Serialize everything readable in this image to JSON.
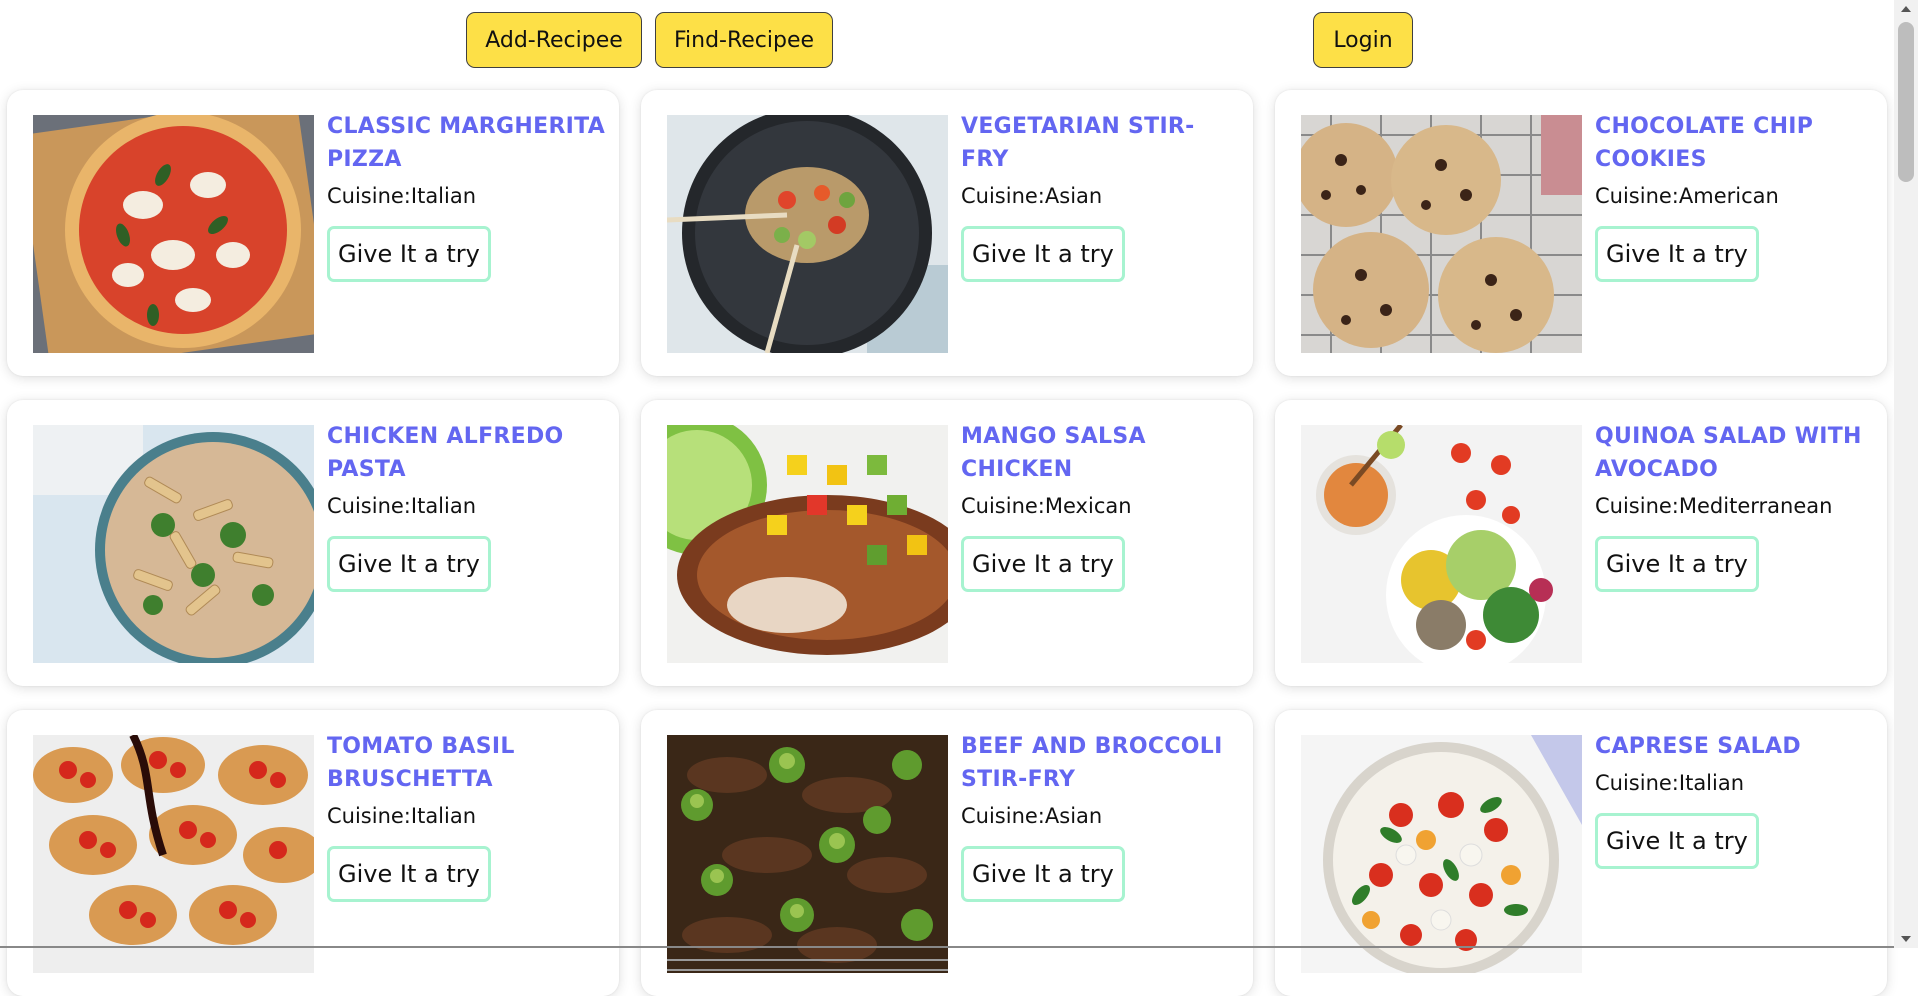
{
  "nav": {
    "add_label": "Add-Recipee",
    "find_label": "Find-Recipee",
    "login_label": "Login"
  },
  "recipes": [
    {
      "title": "Classic Margherita Pizza",
      "cuisine_prefix": "Cuisine:",
      "cuisine": "Italian",
      "button": "Give It a try",
      "image": "pizza"
    },
    {
      "title": "Vegetarian Stir-Fry",
      "cuisine_prefix": "Cuisine:",
      "cuisine": "Asian",
      "button": "Give It a try",
      "image": "stir-fry"
    },
    {
      "title": "Chocolate Chip Cookies",
      "cuisine_prefix": "Cuisine:",
      "cuisine": "American",
      "button": "Give It a try",
      "image": "cookies"
    },
    {
      "title": "Chicken Alfredo Pasta",
      "cuisine_prefix": "Cuisine:",
      "cuisine": "Italian",
      "button": "Give It a try",
      "image": "pasta"
    },
    {
      "title": "Mango Salsa Chicken",
      "cuisine_prefix": "Cuisine:",
      "cuisine": "Mexican",
      "button": "Give It a try",
      "image": "mango-chicken"
    },
    {
      "title": "Quinoa Salad with Avocado",
      "cuisine_prefix": "Cuisine:",
      "cuisine": "Mediterranean",
      "button": "Give It a try",
      "image": "quinoa-salad"
    },
    {
      "title": "Tomato Basil Bruschetta",
      "cuisine_prefix": "Cuisine:",
      "cuisine": "Italian",
      "button": "Give It a try",
      "image": "bruschetta"
    },
    {
      "title": "Beef and Broccoli Stir-Fry",
      "cuisine_prefix": "Cuisine:",
      "cuisine": "Asian",
      "button": "Give It a try",
      "image": "beef-broccoli"
    },
    {
      "title": "Caprese Salad",
      "cuisine_prefix": "Cuisine:",
      "cuisine": "Italian",
      "button": "Give It a try",
      "image": "caprese"
    }
  ],
  "colors": {
    "nav_button": "#fde047",
    "title": "#6366f1",
    "try_border": "#a7f3d0"
  }
}
